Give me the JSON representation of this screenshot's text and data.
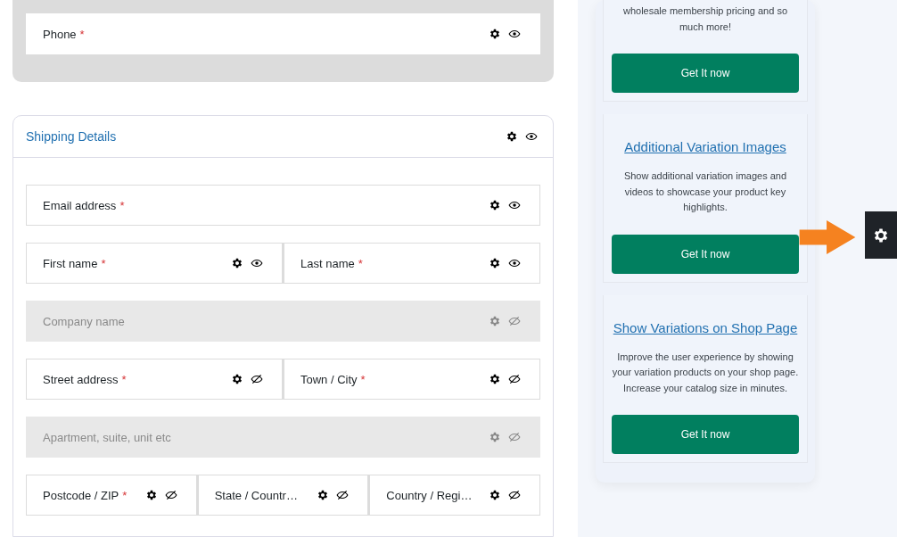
{
  "required_mark": "*",
  "billing_section": {
    "rows": [
      [
        {
          "label": "Phone",
          "required": true,
          "visible": true,
          "enabled": true
        }
      ]
    ]
  },
  "shipping_section": {
    "title": "Shipping Details",
    "visible": true,
    "rows": [
      [
        {
          "label": "Email address",
          "required": true,
          "visible": true,
          "enabled": true
        }
      ],
      [
        {
          "label": "First name",
          "required": true,
          "visible": true,
          "enabled": true
        },
        {
          "label": "Last name",
          "required": true,
          "visible": true,
          "enabled": true
        }
      ],
      [
        {
          "label": "Company name",
          "required": false,
          "visible": false,
          "enabled": false
        }
      ],
      [
        {
          "label": "Street address",
          "required": true,
          "visible": false,
          "enabled": true
        },
        {
          "label": "Town / City",
          "required": true,
          "visible": false,
          "enabled": true
        }
      ],
      [
        {
          "label": "Apartment, suite, unit etc",
          "required": false,
          "visible": false,
          "enabled": false
        }
      ],
      [
        {
          "label": "Postcode / ZIP",
          "required": true,
          "visible": false,
          "enabled": true
        },
        {
          "label": "State / Countr…",
          "required": false,
          "visible": false,
          "enabled": true
        },
        {
          "label": "Country / Regi…",
          "required": false,
          "visible": false,
          "enabled": true
        }
      ]
    ]
  },
  "promos": [
    {
      "description": "wholesale membership pricing and so much more!",
      "button": "Get It now"
    },
    {
      "title": "Additional Variation Images",
      "description": "Show additional variation images and videos to showcase your product key highlights.",
      "button": "Get It now"
    },
    {
      "title": "Show Variations on Shop Page",
      "description": "Improve the user experience by showing your variation products on your shop page. Increase your catalog size in minutes.",
      "button": "Get It now"
    }
  ]
}
